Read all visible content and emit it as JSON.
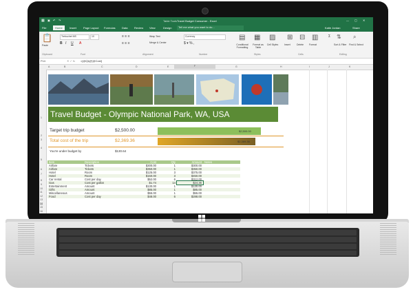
{
  "excel": {
    "title_left": "Travel Budget Consumer - Excel",
    "search_placeholder": "Tell me what you want to do...",
    "user": "Katie Jordan",
    "share": "Share",
    "table_tools": "Table Tools",
    "tabs": [
      "File",
      "Home",
      "Insert",
      "Page Layout",
      "Formulas",
      "Data",
      "Review",
      "View",
      "Design"
    ],
    "font_name": "Trebuchet MS",
    "font_size": "10",
    "number_format": "Currency",
    "wrap_text": "Wrap Text",
    "merge_center": "Merge & Center",
    "ribbon_groups": [
      "Clipboard",
      "Font",
      "Alignment",
      "Number",
      "Styles",
      "Cells",
      "Editing"
    ],
    "ribbon_buttons": [
      "Paste",
      "Conditional Formatting",
      "Format as Table",
      "Cell Styles",
      "Insert",
      "Delete",
      "Format",
      "Sort & Filter",
      "Find & Select"
    ],
    "name_box": "F14",
    "formula": "=[@Qty]*[@Cost]",
    "columns": [
      "A",
      "B",
      "C",
      "D",
      "E",
      "F",
      "G",
      "H",
      "I",
      "J",
      "K"
    ],
    "rows": [
      "1",
      "2",
      "3",
      "4",
      "5",
      "6",
      "7",
      "8",
      "9",
      "10",
      "11",
      "12",
      "13",
      "14",
      "15",
      "16",
      "17",
      "18",
      "19"
    ]
  },
  "sheet": {
    "title": "Travel Budget - Olympic National Park, WA, USA",
    "target_label": "Target trip budget",
    "target_value": "$2,500.00",
    "target_bar_value": "$2,500.00",
    "total_label": "Total cost of the trip",
    "total_value": "$2,369.36",
    "total_bar_value": "$2,369.36",
    "under_label": "You're under budget by",
    "under_value": "$130.64",
    "table_headers": [
      "Item",
      "Description",
      "Cost",
      "Qty",
      "Amount",
      "Notes"
    ],
    "table_rows": [
      [
        "Airfare",
        "Tickets",
        "$300.00",
        "1",
        "$300.00"
      ],
      [
        "Airfare",
        "Tickets",
        "$350.00",
        "1",
        "$350.00"
      ],
      [
        "Hotel",
        "Room",
        "$125.00",
        "3",
        "$375.00"
      ],
      [
        "Hotel",
        "Room",
        "$150.00",
        "3",
        "$450.00"
      ],
      [
        "Car rental",
        "Cost per day",
        "$52.00",
        "6",
        "$312.00"
      ],
      [
        "Gas",
        "Cost per gallon",
        "$1.74",
        "14",
        "$24.36"
      ],
      [
        "Entertainment",
        "Amount",
        "$130.00",
        "1",
        "$130.00"
      ],
      [
        "Gifts",
        "Amount",
        "$85.00",
        "1",
        "$85.00"
      ],
      [
        "Miscellaneous",
        "Amount",
        "$55.00",
        "1",
        "$55.00"
      ],
      [
        "Food",
        "Cost per day",
        "$48.00",
        "6",
        "$288.00"
      ]
    ]
  },
  "colors": {
    "excel_green": "#217346",
    "banner_green": "#5b8b35",
    "orange": "#e0962a",
    "bar_green": "#8dbf5b"
  }
}
